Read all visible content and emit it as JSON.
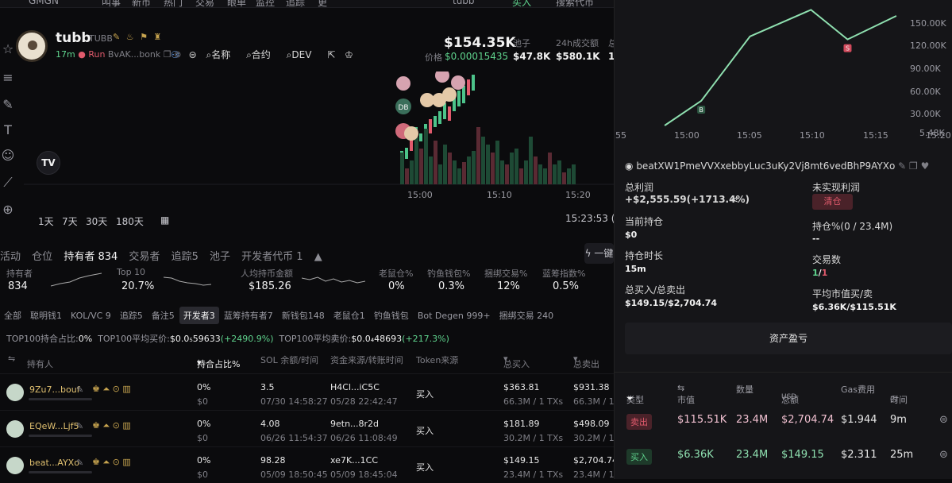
{
  "nav": {
    "items": [
      "叫事",
      "新币",
      "热门",
      "交易",
      "眼单",
      "监控",
      "追踪",
      "更"
    ],
    "user": "tubb",
    "buy": "买入",
    "search_placeholder": "搜索代币"
  },
  "token": {
    "name": "tubb",
    "symbol": "TUBB",
    "age": "17m",
    "run": "Run",
    "address": "BvAK...bonk",
    "links": [
      "名称",
      "合约",
      "DEV"
    ],
    "market_cap": "$154.35K",
    "price_label": "价格",
    "price": "$0.00015435",
    "stats": [
      {
        "label": "池子",
        "value": "$47.8K"
      },
      {
        "label": "24h成交额",
        "value": "$580.1K"
      },
      {
        "label": "总",
        "value": "1"
      }
    ]
  },
  "chart": {
    "x_ticks": [
      "15:00",
      "15:10",
      "15:20"
    ],
    "ranges": [
      "1天",
      "7天",
      "30天",
      "180天"
    ],
    "clock": "15:23:53 (",
    "markers": [
      "DB"
    ]
  },
  "tabs": {
    "items": [
      "活动",
      "仓位",
      "持有者 834",
      "交易者",
      "追踪5",
      "池子",
      "开发者代币 1"
    ],
    "active": 2,
    "button": "一键"
  },
  "summary": [
    {
      "label": "持有者",
      "value": "834"
    },
    {
      "label": "Top 10",
      "value": "20.7%"
    },
    {
      "label": "人均持币金额",
      "value": "$185.26"
    },
    {
      "label": "老鼠仓%",
      "value": "0%"
    },
    {
      "label": "钓鱼钱包%",
      "value": "0.3%"
    },
    {
      "label": "捆绑交易%",
      "value": "12%"
    },
    {
      "label": "蓝筹指数%",
      "value": "0.5%"
    }
  ],
  "chips": {
    "items": [
      "全部",
      "聪明钱1",
      "KOL/VC 9",
      "追踪5",
      "备注5",
      "开发者3",
      "蓝筹持有者7",
      "新钱包148",
      "老鼠仓1",
      "钓鱼钱包",
      "Bot Degen 999+",
      "捆绑交易 240"
    ],
    "active": 5
  },
  "top100": {
    "label1": "TOP100持合占比:",
    "v1": "0%",
    "label2": "TOP100平均买价:",
    "v2": "$0.0₅59633",
    "v2c": "(+2490.9%)",
    "label3": "TOP100平均卖价:",
    "v3": "$0.0₄48693",
    "v3c": "(+217.3%)"
  },
  "table": {
    "headers": [
      "持有人",
      "持合占比%",
      "SOL 余额/时间",
      "资金来源/转账时间",
      "Token来源",
      "总买入",
      "总卖出"
    ],
    "rows": [
      {
        "holder": "9Zu7...bouf",
        "pct": "0%",
        "pct2": "$0",
        "sol": "3.5",
        "sol_time": "07/30 14:58:27",
        "src": "H4Cl...iC5C",
        "src_time": "05/28 22:42:47",
        "token_src": "买入",
        "buy": "$363.81",
        "buy_sub": "66.3M / 1 TXs",
        "sell": "$931.38",
        "sell_sub": "66.3M / 1 T"
      },
      {
        "holder": "EQeW...Ljf5",
        "pct": "0%",
        "pct2": "$0",
        "sol": "4.08",
        "sol_time": "06/26 11:54:37",
        "src": "9etn...8r2d",
        "src_time": "06/26 11:08:49",
        "token_src": "买入",
        "buy": "$181.89",
        "buy_sub": "30.2M / 1 TXs",
        "sell": "$498.09",
        "sell_sub": "30.2M / 1 T"
      },
      {
        "holder": "beat...AYXo",
        "pct": "0%",
        "pct2": "$0",
        "sol": "98.28",
        "sol_time": "05/09 18:50:45",
        "src": "xe7K...1CC",
        "src_time": "05/09 18:45:04",
        "token_src": "买入",
        "buy": "$149.15",
        "buy_sub": "23.4M / 1 TXs",
        "sell": "$2,704.74",
        "sell_sub": "23.4M / 1 T"
      }
    ]
  },
  "right": {
    "chart_data": {
      "type": "line",
      "x_ticks": [
        "55",
        "15:00",
        "15:05",
        "15:10",
        "15:15",
        "15:20"
      ],
      "y_ticks": [
        "150.00K",
        "120.00K",
        "90.00K",
        "60.00K",
        "30.00K",
        "5.48K"
      ],
      "points": [
        {
          "t": "14:58",
          "v": 5.48
        },
        {
          "t": "15:01",
          "v": 38
        },
        {
          "t": "15:05",
          "v": 123
        },
        {
          "t": "15:10",
          "v": 158
        },
        {
          "t": "15:13",
          "v": 119
        },
        {
          "t": "15:17",
          "v": 150
        }
      ],
      "markers": [
        {
          "label": "B",
          "t": "15:01"
        },
        {
          "label": "S",
          "t": "15:13"
        }
      ]
    },
    "address": "beatXW1PmeVVXxebbyLuc3uKy2Vj8mt6vedBhP9AYXo",
    "total_profit_label": "总利润",
    "total_profit": "+$2,555.59(+1713.4%)",
    "unrealized_label": "未实现利润",
    "clear_label": "清仓",
    "holding_label": "当前持仓",
    "holding": "$0",
    "hold_pct_label": "持仓%(0 / 23.4M)",
    "hold_pct": "--",
    "hold_time_label": "持仓时长",
    "hold_time": "15m",
    "trades_label": "交易数",
    "trades_buy": "1",
    "trades_sell": "1",
    "buysell_label": "总买入/总卖出",
    "buysell": "$149.15/$2,704.74",
    "avg_mcap_label": "平均市值买/卖",
    "avg_mcap": "$6.36K/$115.51K",
    "pnl_button": "资产盈亏",
    "headers": [
      "类型",
      "市值",
      "数量",
      "总额",
      "USD",
      "Gas费用",
      "时间"
    ],
    "trades": [
      {
        "type": "卖出",
        "mcap": "$115.51K",
        "amount": "23.4M",
        "total": "$2,704.74",
        "gas": "$1.944",
        "time": "9m"
      },
      {
        "type": "买入",
        "mcap": "$6.36K",
        "amount": "23.4M",
        "total": "$149.15",
        "gas": "$2.311",
        "time": "25m"
      }
    ]
  }
}
